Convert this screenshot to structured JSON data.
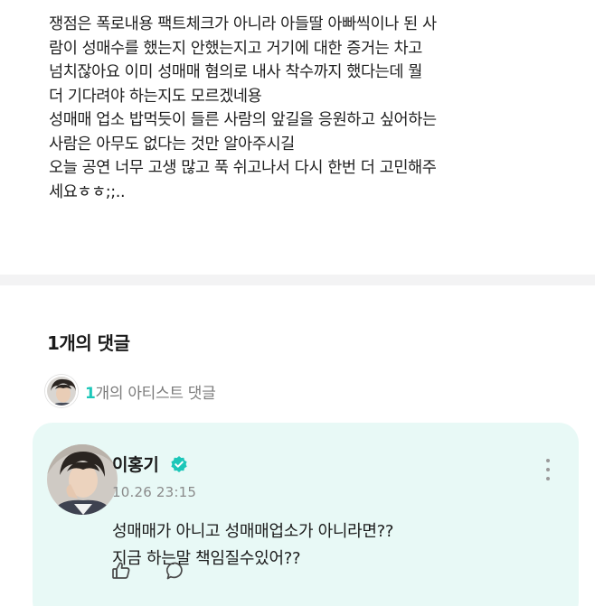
{
  "post": {
    "lines": [
      "쟁점은 폭로내용 팩트체크가 아니라 아들딸 아빠씩이나 된 사",
      "람이 성매수를 했는지 안했는지고 거기에 대한 증거는 차고",
      "넘치잖아요 이미 성매매 혐의로 내사 착수까지 했다는데 뭘",
      "더 기다려야 하는지도 모르겠네용",
      "성매매 업소 밥먹듯이 들른 사람의 앞길을 응원하고 싶어하는",
      "사람은 아무도 없다는 것만 알아주시길",
      "오늘 공연 너무 고생 많고 푹 쉬고나서 다시 한번 더 고민해주",
      "세요ㅎㅎ;;.."
    ]
  },
  "comments": {
    "count_label": "1개의 댓글",
    "artist_count_num": "1",
    "artist_count_text": "개의 아티스트 댓글"
  },
  "artist_comment": {
    "author": "이홍기",
    "timestamp": "10.26 23:15",
    "lines": [
      "성매매가 아니고 성매매업소가 아니라면??",
      "지금 하는말 책임질수있어??"
    ],
    "icons": {
      "verified": "verified-badge-icon",
      "more": "more-vertical-icon",
      "like": "like-icon",
      "reply": "comment-bubble-icon"
    }
  },
  "colors": {
    "accent": "#1cc7b9",
    "card_bg": "#e8f9f6",
    "divider": "#f3f3f4",
    "muted": "#8a8a8a"
  }
}
